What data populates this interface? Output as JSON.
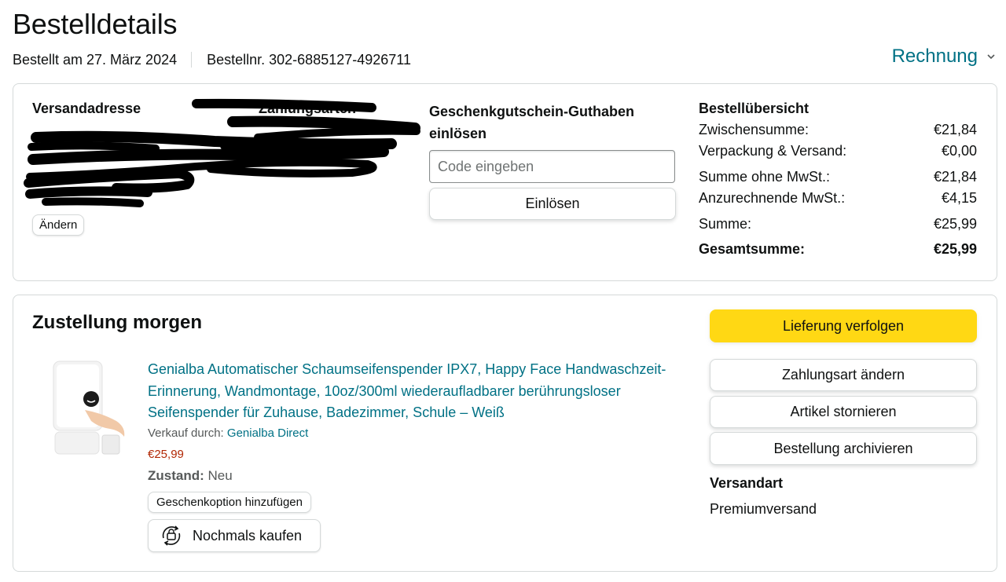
{
  "header": {
    "title": "Bestelldetails",
    "ordered_on": "Bestellt am 27. März 2024",
    "order_number": "Bestellnr. 302-6885127-4926711",
    "invoice_label": "Rechnung"
  },
  "address": {
    "heading": "Versandadresse",
    "change_label": "Ändern"
  },
  "payment": {
    "heading": "Zahlungsarten"
  },
  "gift_card": {
    "heading": "Geschenkgutschein-Guthaben einlösen",
    "placeholder": "Code eingeben",
    "redeem_label": "Einlösen"
  },
  "summary": {
    "heading": "Bestellübersicht",
    "rows": [
      {
        "label": "Zwischensumme:",
        "value": "€21,84"
      },
      {
        "label": "Verpackung & Versand:",
        "value": "€0,00"
      },
      {
        "label": "Summe ohne MwSt.:",
        "value": "€21,84"
      },
      {
        "label": "Anzurechnende MwSt.:",
        "value": "€4,15"
      },
      {
        "label": "Summe:",
        "value": "€25,99"
      },
      {
        "label": "Gesamtsumme:",
        "value": "€25,99"
      }
    ]
  },
  "delivery": {
    "heading": "Zustellung morgen",
    "product": {
      "title": "Genialba Automatischer Schaumseifenspender IPX7, Happy Face Handwaschzeit-Erinnerung, Wandmontage, 10oz/300ml wiederaufladbarer berührungsloser Seifenspender für Zuhause, Badezimmer, Schule – Weiß",
      "sold_by_label": "Verkauf durch:",
      "seller": "Genialba Direct",
      "price": "€25,99",
      "condition_label": "Zustand:",
      "condition_value": "Neu",
      "gift_option_label": "Geschenkoption hinzufügen",
      "buy_again_label": "Nochmals kaufen"
    },
    "actions": {
      "track": "Lieferung verfolgen",
      "change_payment": "Zahlungsart ändern",
      "cancel_items": "Artikel stornieren",
      "archive_order": "Bestellung archivieren"
    },
    "shipping_method_label": "Versandart",
    "shipping_method_value": "Premiumversand"
  },
  "colors": {
    "link": "#007185",
    "price": "#B12704",
    "primary_button": "#FFD814",
    "border": "#D5D9D9"
  }
}
